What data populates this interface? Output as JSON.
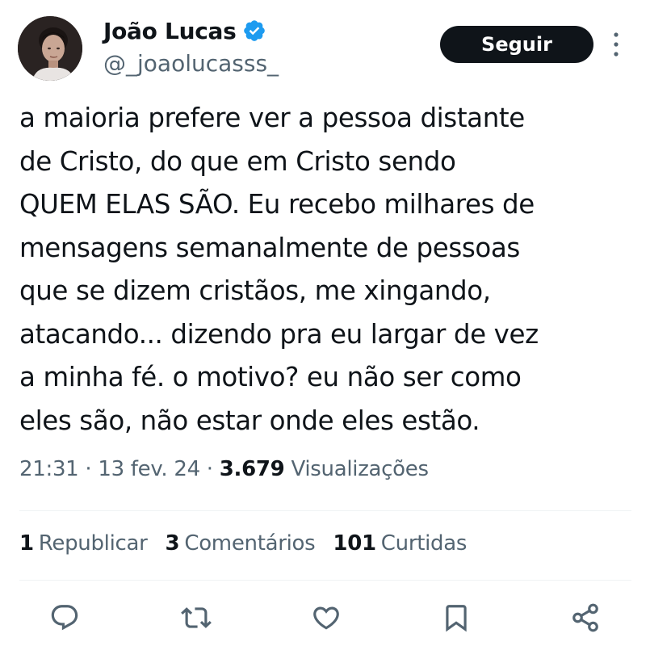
{
  "author": {
    "display_name": "João Lucas",
    "handle": "@_joaolucasss_",
    "verified_icon": "verified-badge-icon",
    "avatar_icon": "avatar-photo"
  },
  "header": {
    "follow_label": "Seguir",
    "more_icon": "more-vertical-icon"
  },
  "tweet": {
    "text": "a maioria prefere ver a pessoa distante\nde Cristo, do que em Cristo sendo\nQUEM ELAS SÃO. Eu recebo milhares de\nmensagens semanalmente de pessoas\nque se dizem cristãos, me xingando,\natacando... dizendo pra eu largar de vez\na minha fé. o motivo? eu não ser como\neles são, não estar onde eles estão."
  },
  "meta": {
    "time": "21:31",
    "separator1": " · ",
    "date": "13 fev. 24",
    "separator2": " · ",
    "views_count": "3.679",
    "views_label": " Visualizações"
  },
  "stats": [
    {
      "count": "1",
      "label": "Republicar"
    },
    {
      "count": "3",
      "label": "Comentários"
    },
    {
      "count": "101",
      "label": "Curtidas"
    }
  ],
  "actions": [
    {
      "icon": "reply-icon"
    },
    {
      "icon": "repost-icon"
    },
    {
      "icon": "like-icon"
    },
    {
      "icon": "bookmark-icon"
    },
    {
      "icon": "share-icon"
    }
  ],
  "colors": {
    "text_primary": "#0f1419",
    "text_secondary": "#536471",
    "verified_blue": "#1d9bf0",
    "divider": "#eff3f4",
    "button_bg": "#0f1419"
  }
}
